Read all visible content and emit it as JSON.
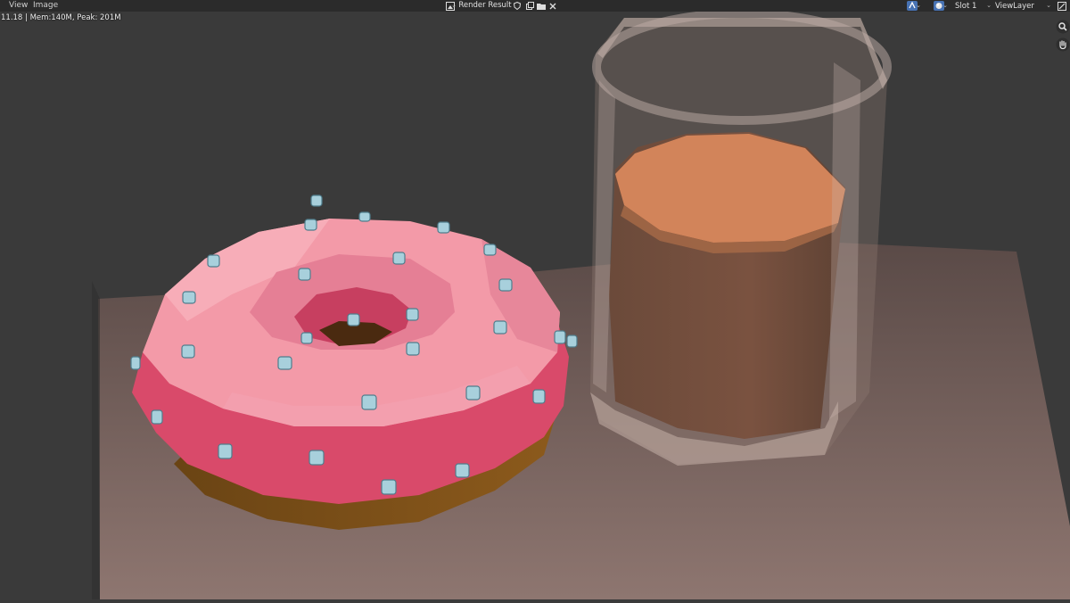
{
  "menu": {
    "view": "View",
    "image": "Image"
  },
  "header": {
    "image_name": "Render Result",
    "slot": "Slot 1",
    "view_layer": "ViewLayer"
  },
  "render_stats": "11.18 | Mem:140M, Peak: 201M",
  "icons": {
    "image_browse": "image-icon",
    "fake_user": "shield-icon",
    "new_image": "duplicate-icon",
    "open_image": "folder-icon",
    "unlink_image": "close-icon",
    "display_channels": "color-alpha-icon",
    "view_shading": "material-sphere-icon",
    "sidebar": "sidebar-toggle-icon",
    "zoom": "zoom-icon",
    "pan": "hand-pan-icon"
  },
  "colors": {
    "background": "#3a3a3a",
    "header": "#2b2b2b",
    "accent": "#4772b3",
    "icing": "#e86a85",
    "dough": "#8a5a1e",
    "sprinkles": "#a8d0dc",
    "liquid": "#8d5f48"
  }
}
